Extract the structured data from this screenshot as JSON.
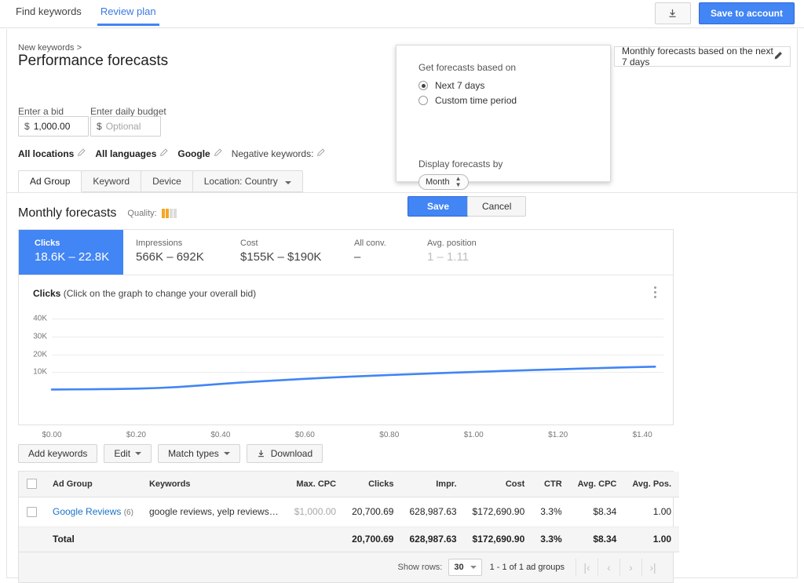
{
  "topbar": {
    "tabs": [
      {
        "label": "Find keywords",
        "active": false
      },
      {
        "label": "Review plan",
        "active": true
      }
    ],
    "download_icon": "download-icon",
    "save_button": "Save to account"
  },
  "header": {
    "breadcrumb": "New keywords >",
    "title": "Performance forecasts"
  },
  "bid": {
    "bid_label": "Enter a bid",
    "bid_currency": "$",
    "bid_value": "1,000.00",
    "budget_label": "Enter daily budget",
    "budget_currency": "$",
    "budget_placeholder": "Optional"
  },
  "settings": {
    "locations": "All locations",
    "languages": "All languages",
    "network": "Google",
    "negative_keywords": "Negative keywords:",
    "edit_icon": "pencil-icon"
  },
  "segment_tabs": [
    {
      "label": "Ad Group",
      "active": true
    },
    {
      "label": "Keyword",
      "active": false
    },
    {
      "label": "Device",
      "active": false
    },
    {
      "label": "Location: Country",
      "active": false,
      "caret": true
    }
  ],
  "section": {
    "title": "Monthly forecasts",
    "quality_label": "Quality:",
    "quality_filled": 2,
    "quality_total": 4,
    "quality_color": "#f5a623"
  },
  "metrics": [
    {
      "name": "Clicks",
      "value": "18.6K – 22.8K",
      "selected": true,
      "muted": false,
      "width": 133
    },
    {
      "name": "Impressions",
      "value": "566K – 692K",
      "selected": false,
      "muted": false,
      "width": 133
    },
    {
      "name": "Cost",
      "value": "$155K – $190K",
      "selected": false,
      "muted": false,
      "width": 145
    },
    {
      "name": "All conv.",
      "value": "–",
      "selected": false,
      "muted": false,
      "width": 93
    },
    {
      "name": "Avg. position",
      "value": "1 – 1.11",
      "selected": false,
      "muted": true,
      "width": 150
    }
  ],
  "chart_data": {
    "type": "line",
    "title": "Clicks",
    "subtitle": "(Click on the graph to change your overall bid)",
    "xlabel": "",
    "ylabel": "",
    "grid": true,
    "legend": "none",
    "series_color": "#4285f4",
    "x_ticks": [
      "$0.00",
      "$0.20",
      "$0.40",
      "$0.60",
      "$0.80",
      "$1.00",
      "$1.20",
      "$1.40"
    ],
    "x_tick_values": [
      0.0,
      0.2,
      0.4,
      0.6,
      0.8,
      1.0,
      1.2,
      1.4
    ],
    "y_ticks": [
      "10K",
      "20K",
      "30K",
      "40K"
    ],
    "y_tick_values": [
      10000,
      20000,
      30000,
      40000
    ],
    "xlim": [
      0.0,
      1.45
    ],
    "ylim": [
      0,
      44000
    ],
    "series": [
      {
        "name": "Clicks",
        "x": [
          0.0,
          0.05,
          0.1,
          0.15,
          0.2,
          0.25,
          0.3,
          0.35,
          0.4,
          0.45,
          0.5,
          0.55,
          0.6,
          0.65,
          0.7,
          0.75,
          0.8,
          0.85,
          0.9,
          0.95,
          1.0,
          1.05,
          1.1,
          1.15,
          1.2,
          1.25,
          1.3,
          1.35,
          1.4,
          1.43
        ],
        "values": [
          260,
          330,
          420,
          540,
          720,
          1100,
          1700,
          2500,
          3400,
          4200,
          4900,
          5600,
          6250,
          6850,
          7400,
          7900,
          8400,
          8850,
          9280,
          9700,
          10100,
          10500,
          10880,
          11250,
          11600,
          11950,
          12280,
          12600,
          12900,
          13050
        ]
      }
    ]
  },
  "table_toolbar": {
    "add_keywords": "Add keywords",
    "edit": "Edit",
    "match_types": "Match types",
    "download": "Download",
    "download_icon": "download-icon"
  },
  "table": {
    "columns": [
      {
        "label": "",
        "key": "checkbox",
        "align": "left"
      },
      {
        "label": "Ad Group",
        "key": "ad_group",
        "align": "left"
      },
      {
        "label": "Keywords",
        "key": "keywords",
        "align": "left"
      },
      {
        "label": "Max. CPC",
        "key": "max_cpc",
        "align": "right"
      },
      {
        "label": "Clicks",
        "key": "clicks",
        "align": "right"
      },
      {
        "label": "Impr.",
        "key": "impr",
        "align": "right"
      },
      {
        "label": "Cost",
        "key": "cost",
        "align": "right"
      },
      {
        "label": "CTR",
        "key": "ctr",
        "align": "right"
      },
      {
        "label": "Avg. CPC",
        "key": "avg_cpc",
        "align": "right"
      },
      {
        "label": "Avg. Pos.",
        "key": "avg_pos",
        "align": "right"
      }
    ],
    "rows": [
      {
        "ad_group": "Google Reviews",
        "ad_group_count": "(6)",
        "keywords": "google reviews, yelp reviews…",
        "max_cpc": "$1,000.00",
        "clicks": "20,700.69",
        "impr": "628,987.63",
        "cost": "$172,690.90",
        "ctr": "3.3%",
        "avg_cpc": "$8.34",
        "avg_pos": "1.00"
      }
    ],
    "total": {
      "label": "Total",
      "clicks": "20,700.69",
      "impr": "628,987.63",
      "cost": "$172,690.90",
      "ctr": "3.3%",
      "avg_cpc": "$8.34",
      "avg_pos": "1.00"
    },
    "pagination": {
      "show_rows_label": "Show rows:",
      "rows_per_page": "30",
      "range_text": "1 - 1 of 1 ad groups",
      "first": "|‹",
      "prev": "‹",
      "next": "›",
      "last": "›|"
    }
  },
  "forecast_chip": {
    "text": "Monthly forecasts based on the next 7 days",
    "edit_icon": "pencil-icon"
  },
  "popover": {
    "heading": "Get forecasts based on",
    "options": [
      {
        "label": "Next 7 days",
        "selected": true
      },
      {
        "label": "Custom time period",
        "selected": false
      }
    ],
    "display_heading": "Display forecasts by",
    "display_value": "Month",
    "save": "Save",
    "cancel": "Cancel"
  }
}
